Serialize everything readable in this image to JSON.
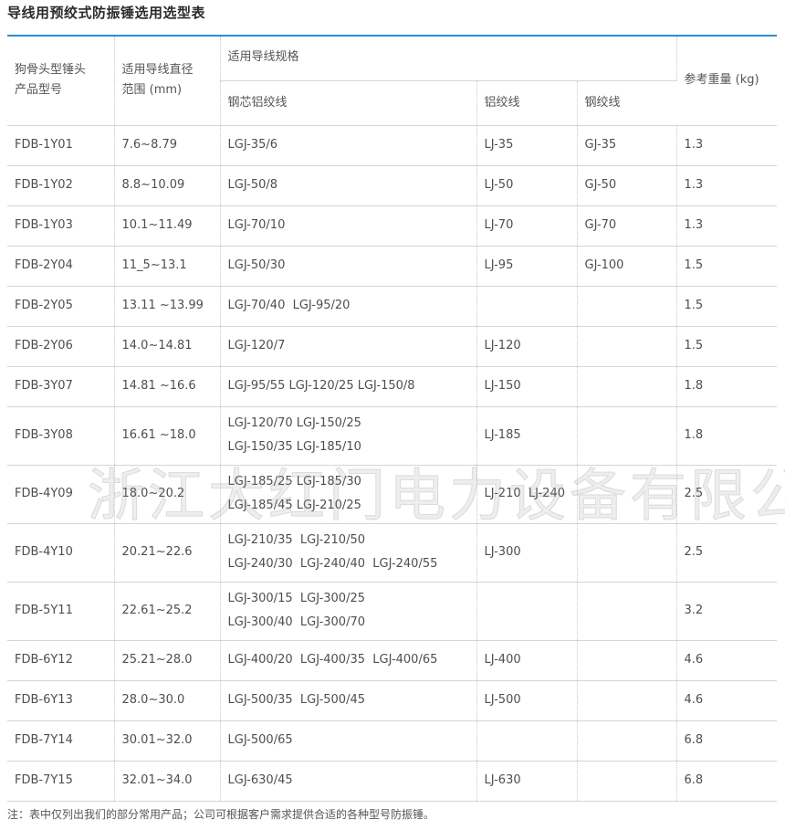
{
  "title": "导线用预绞式防振锤选用选型表",
  "headers": {
    "model": "狗骨头型锤头产品型号",
    "diameter": "适用导线直径范围 (mm)",
    "spec": "适用导线规格",
    "acsr": "钢芯铝绞线",
    "al": "铝绞线",
    "steel": "钢绞线",
    "weight": "参考重量 (kg)"
  },
  "rows": [
    {
      "model": "FDB-1Y01",
      "diameter": "7.6~8.79",
      "acsr": [
        "LGJ-35/6"
      ],
      "al": "LJ-35",
      "steel": "GJ-35",
      "weight": "1.3"
    },
    {
      "model": "FDB-1Y02",
      "diameter": "8.8~10.09",
      "acsr": [
        "LGJ-50/8"
      ],
      "al": "LJ-50",
      "steel": "GJ-50",
      "weight": "1.3"
    },
    {
      "model": "FDB-1Y03",
      "diameter": "10.1~11.49",
      "acsr": [
        "LGJ-70/10"
      ],
      "al": "LJ-70",
      "steel": "GJ-70",
      "weight": "1.3"
    },
    {
      "model": "FDB-2Y04",
      "diameter": "11_5~13.1",
      "acsr": [
        "LGJ-50/30"
      ],
      "al": "LJ-95",
      "steel": "GJ-100",
      "weight": "1.5"
    },
    {
      "model": "FDB-2Y05",
      "diameter": "13.11 ~13.99",
      "acsr": [
        "LGJ-70/40  LGJ-95/20"
      ],
      "al": "",
      "steel": "",
      "weight": "1.5"
    },
    {
      "model": "FDB-2Y06",
      "diameter": "14.0~14.81",
      "acsr": [
        "LGJ-120/7"
      ],
      "al": "LJ-120",
      "steel": "",
      "weight": "1.5"
    },
    {
      "model": "FDB-3Y07",
      "diameter": "14.81 ~16.6",
      "acsr": [
        "LGJ-95/55 LGJ-120/25 LGJ-150/8"
      ],
      "al": "LJ-150",
      "steel": "",
      "weight": "1.8"
    },
    {
      "model": "FDB-3Y08",
      "diameter": "16.61 ~18.0",
      "acsr": [
        "LGJ-120/70 LGJ-150/25",
        "LGJ-150/35 LGJ-185/10"
      ],
      "al": "LJ-185",
      "steel": "",
      "weight": "1.8"
    },
    {
      "model": "FDB-4Y09",
      "diameter": "18.0~20.2",
      "acsr": [
        "LGJ-185/25 LGJ-185/30",
        "LGJ-185/45 LGJ-210/25"
      ],
      "al": "LJ-210  LJ-240",
      "steel": "",
      "weight": "2.5"
    },
    {
      "model": "FDB-4Y10",
      "diameter": "20.21~22.6",
      "acsr": [
        "LGJ-210/35  LGJ-210/50",
        "LGJ-240/30  LGJ-240/40  LGJ-240/55"
      ],
      "al": "LJ-300",
      "steel": "",
      "weight": "2.5"
    },
    {
      "model": "FDB-5Y11",
      "diameter": "22.61~25.2",
      "acsr": [
        "LGJ-300/15  LGJ-300/25",
        "LGJ-300/40  LGJ-300/70"
      ],
      "al": "",
      "steel": "",
      "weight": "3.2"
    },
    {
      "model": "FDB-6Y12",
      "diameter": "25.21~28.0",
      "acsr": [
        "LGJ-400/20  LGJ-400/35  LGJ-400/65"
      ],
      "al": "LJ-400",
      "steel": "",
      "weight": "4.6"
    },
    {
      "model": "FDB-6Y13",
      "diameter": "28.0~30.0",
      "acsr": [
        "LGJ-500/35  LGJ-500/45"
      ],
      "al": "LJ-500",
      "steel": "",
      "weight": "4.6"
    },
    {
      "model": "FDB-7Y14",
      "diameter": "30.01~32.0",
      "acsr": [
        "LGJ-500/65"
      ],
      "al": "",
      "steel": "",
      "weight": "6.8"
    },
    {
      "model": "FDB-7Y15",
      "diameter": "32.01~34.0",
      "acsr": [
        "LGJ-630/45"
      ],
      "al": "LJ-630",
      "steel": "",
      "weight": "6.8"
    }
  ],
  "note": "注：表中仅列出我们的部分常用产品；公司可根据客户需求提供合适的各种型号防振锤。",
  "watermark": "浙江大红门电力设备有限公司",
  "colors": {
    "accent": "#2b8fd6",
    "border": "#d5d5d5"
  }
}
